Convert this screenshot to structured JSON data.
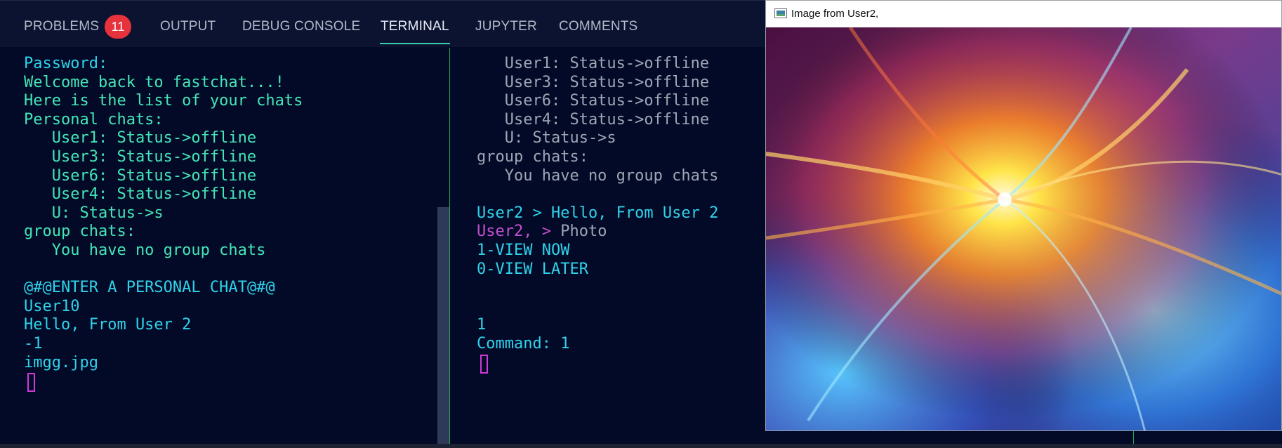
{
  "panel_tabs": [
    {
      "label": "PROBLEMS",
      "badge": "11"
    },
    {
      "label": "OUTPUT"
    },
    {
      "label": "DEBUG CONSOLE"
    },
    {
      "label": "TERMINAL",
      "active": true
    },
    {
      "label": "JUPYTER"
    },
    {
      "label": "COMMENTS"
    }
  ],
  "terminal_left": {
    "lines": [
      {
        "text": "Password:",
        "color": "cyan"
      },
      {
        "text": "Welcome back to fastchat...!",
        "color": "teal"
      },
      {
        "text": "Here is the list of your chats",
        "color": "teal"
      },
      {
        "text": "Personal chats:",
        "color": "teal"
      },
      {
        "text": "   User1: Status->offline",
        "color": "teal"
      },
      {
        "text": "   User3: Status->offline",
        "color": "teal"
      },
      {
        "text": "   User6: Status->offline",
        "color": "teal"
      },
      {
        "text": "   User4: Status->offline",
        "color": "teal"
      },
      {
        "text": "   U: Status->s",
        "color": "teal"
      },
      {
        "text": "group chats:",
        "color": "teal"
      },
      {
        "text": "   You have no group chats",
        "color": "teal"
      },
      {
        "text": "",
        "color": "teal"
      },
      {
        "text": "@#@ENTER A PERSONAL CHAT@#@",
        "color": "cyan"
      },
      {
        "text": "User10",
        "color": "cyan"
      },
      {
        "text": "Hello, From User 2",
        "color": "cyan"
      },
      {
        "text": "-1",
        "color": "cyan"
      },
      {
        "text": "imgg.jpg",
        "color": "cyan"
      }
    ]
  },
  "terminal_right": {
    "lines": [
      {
        "text": "   User1: Status->offline",
        "color": "gray"
      },
      {
        "text": "   User3: Status->offline",
        "color": "gray"
      },
      {
        "text": "   User6: Status->offline",
        "color": "gray"
      },
      {
        "text": "   User4: Status->offline",
        "color": "gray"
      },
      {
        "text": "   U: Status->s",
        "color": "gray"
      },
      {
        "text": "group chats:",
        "color": "gray"
      },
      {
        "text": "   You have no group chats",
        "color": "gray"
      },
      {
        "text": "",
        "color": "gray"
      },
      {
        "text": "User2 > Hello, From User 2",
        "color": "cyan"
      },
      {
        "segments": [
          {
            "text": "User2, > ",
            "color": "magenta"
          },
          {
            "text": "Photo",
            "color": "gray"
          }
        ]
      },
      {
        "text": "1-VIEW NOW",
        "color": "cyan"
      },
      {
        "text": "0-VIEW LATER",
        "color": "cyan"
      },
      {
        "text": "",
        "color": "cyan"
      },
      {
        "text": "",
        "color": "cyan"
      },
      {
        "text": "1",
        "color": "cyan"
      },
      {
        "text": "Command: 1",
        "color": "cyan"
      }
    ]
  },
  "image_window": {
    "title": "Image from User2,",
    "icon": "app-window-icon"
  },
  "colors": {
    "terminal_bg": "#030a28",
    "panel_bg": "#0c1331",
    "cyan": "#2fd3ea",
    "teal": "#44e6b6",
    "gray": "#9fa6b4",
    "magenta": "#c44fd0",
    "badge": "#e5323b",
    "active_tab_underline": "#36d0a6",
    "divider": "#1fa84d"
  }
}
